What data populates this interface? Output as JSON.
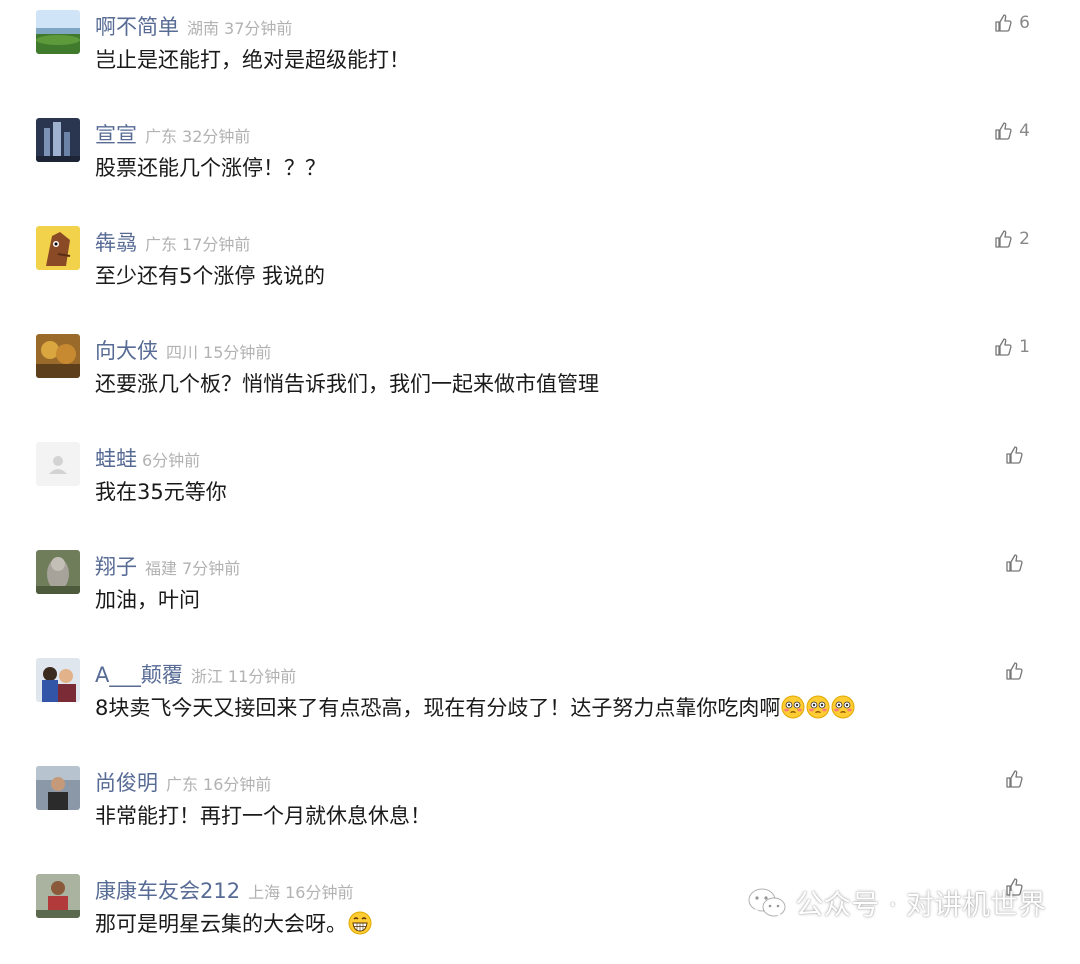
{
  "comments": [
    {
      "name": "啊不简单",
      "region": "湖南",
      "time": "37分钟前",
      "text": "岂止是还能打，绝对是超级能打！",
      "likes": "6",
      "emoji_count": 0
    },
    {
      "name": "宣宣",
      "region": "广东",
      "time": "32分钟前",
      "text": "股票还能几个涨停！？？",
      "likes": "4",
      "emoji_count": 0
    },
    {
      "name": "犇骉",
      "region": "广东",
      "time": "17分钟前",
      "text": "至少还有5个涨停 我说的",
      "likes": "2",
      "emoji_count": 0
    },
    {
      "name": "向大侠",
      "region": "四川",
      "time": "15分钟前",
      "text": "还要涨几个板？悄悄告诉我们，我们一起来做市值管理",
      "likes": "1",
      "emoji_count": 0
    },
    {
      "name": "蛙蛙",
      "region": "",
      "time": "6分钟前",
      "text": "我在35元等你",
      "likes": "",
      "emoji_count": 0
    },
    {
      "name": "翔子",
      "region": "福建",
      "time": "7分钟前",
      "text": "加油，叶问",
      "likes": "",
      "emoji_count": 0
    },
    {
      "name": "A___颠覆",
      "region": "浙江",
      "time": "11分钟前",
      "text": "8块卖飞今天又接回来了有点恐高，现在有分歧了！达子努力点靠你吃肉啊",
      "likes": "",
      "emoji_count": 3
    },
    {
      "name": "尚俊明",
      "region": "广东",
      "time": "16分钟前",
      "text": "非常能打！再打一个月就休息休息！",
      "likes": "",
      "emoji_count": 0
    },
    {
      "name": "康康车友会212",
      "region": "上海",
      "time": "16分钟前",
      "text": "那可是明星云集的大会呀。",
      "likes": "",
      "emoji_count": 1
    }
  ],
  "icons": {
    "like": "thumbs-up-outline-icon",
    "emoji_row7": "flushed-face-emoji",
    "emoji_row9": "grinning-face-emoji"
  },
  "watermark": {
    "text": "公众号 · 对讲机世界",
    "icon": "wechat-logo-icon"
  },
  "colors": {
    "nickname": "#576b95",
    "meta": "#b2b2b2",
    "text": "#1a1a1a"
  }
}
